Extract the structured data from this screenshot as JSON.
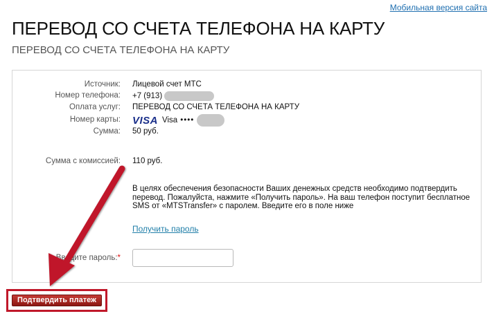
{
  "header": {
    "mobile_link": "Мобильная версия сайта",
    "title": "ПЕРЕВОД СО СЧЕТА ТЕЛЕФОНА НА КАРТУ",
    "subtitle": "ПЕРЕВОД СО СЧЕТА ТЕЛЕФОНА НА КАРТУ"
  },
  "details": {
    "source_label": "Источник:",
    "source_value": "Лицевой счет МТС",
    "phone_label": "Номер телефона:",
    "phone_value": "+7 (913) ",
    "service_label": "Оплата услуг:",
    "service_value": "ПЕРЕВОД СО СЧЕТА ТЕЛЕФОНА НА КАРТУ",
    "card_label": "Номер карты:",
    "card_logo": "VISA",
    "card_value": "Visa",
    "card_dots": "••••",
    "amount_label": "Сумма:",
    "amount_value": "50 руб.",
    "total_label": "Сумма с комиссией:",
    "total_value": "110 руб."
  },
  "notice": {
    "text": "В целях обеспечения безопасности Ваших денежных средств необходимо подтвердить перевод. Пожалуйста, нажмите «Получить пароль». На ваш телефон поступит бесплатное SMS от «MTSTransfer» с паролем. Введите его в поле ниже",
    "get_password_link": "Получить пароль"
  },
  "password": {
    "label": "Введите пароль:",
    "required_mark": "*",
    "value": "",
    "placeholder": ""
  },
  "actions": {
    "confirm_label": "Подтвердить платеж"
  },
  "colors": {
    "annotation_red": "#c0182a",
    "link_blue": "#1f7ea8",
    "visa_blue": "#1a2f8a"
  }
}
